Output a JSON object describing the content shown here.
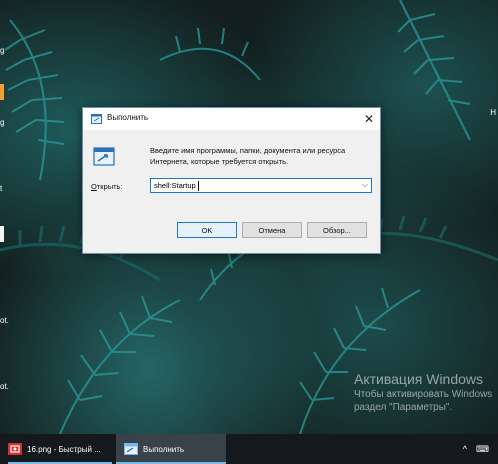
{
  "desktop": {
    "left_fragments": [
      "g",
      "g",
      "t",
      "ot.",
      "ot."
    ],
    "right_fragment": "H"
  },
  "activation": {
    "title": "Активация Windows",
    "line1": "Чтобы активировать Windows",
    "line2": "раздел \"Параметры\"."
  },
  "run_dialog": {
    "title": "Выполнить",
    "description": "Введите имя программы, папки, документа или ресурса Интернета, которые требуется открыть.",
    "open_label_underlined": "О",
    "open_label_rest": "ткрыть:",
    "input_value": "shell:Startup",
    "ok_label": "OK",
    "cancel_label": "Отмена",
    "browse_label": "Обзор..."
  },
  "taskbar": {
    "items": [
      {
        "label": "16.png - Быстрый ...",
        "icon": "camera-icon"
      },
      {
        "label": "Выполнить",
        "icon": "run-icon"
      }
    ],
    "tray": {
      "chevron": "^",
      "lang": "⌨"
    }
  },
  "colors": {
    "accent": "#1e78d2",
    "taskbar": "#16191c"
  }
}
